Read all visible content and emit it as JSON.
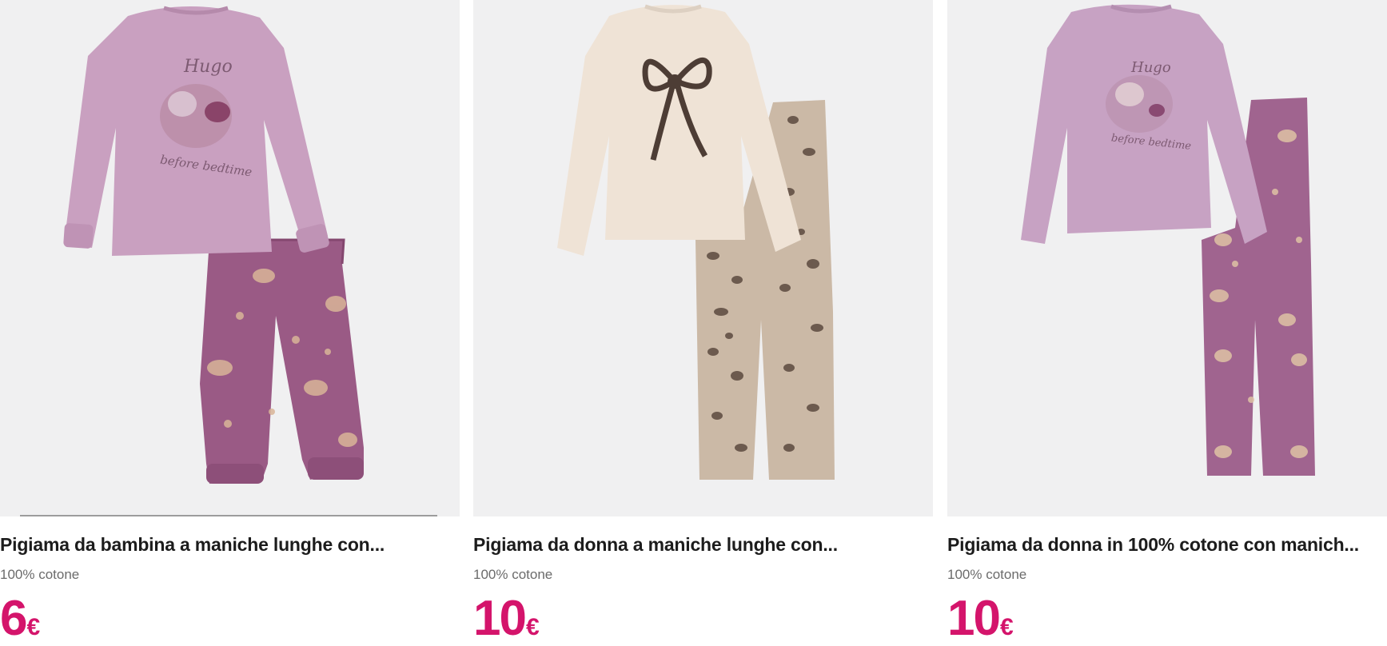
{
  "products": [
    {
      "title": "Pigiama da bambina a maniche lunghe con...",
      "material": "100% cotone",
      "price": "6",
      "currency": "€",
      "image": "girls-pajama-squirrel-print",
      "print_text": "Hugo",
      "print_text2": "before bedtime",
      "top_color": "#c9a0c0",
      "bottom_color": "#9a5a85"
    },
    {
      "title": "Pigiama da donna a maniche lunghe con...",
      "material": "100% cotone",
      "price": "10",
      "currency": "€",
      "image": "womens-pajama-bow-leopard",
      "top_color": "#efe3d6",
      "bottom_color": "#cbb9a6"
    },
    {
      "title": "Pigiama da donna in 100% cotone con manich...",
      "material": "100% cotone",
      "price": "10",
      "currency": "€",
      "image": "womens-pajama-squirrel-print",
      "print_text": "Hugo",
      "print_text2": "before bedtime",
      "top_color": "#c7a2c3",
      "bottom_color": "#a0648f"
    }
  ],
  "colors": {
    "price": "#d4146b",
    "image_bg": "#f0f0f1"
  }
}
